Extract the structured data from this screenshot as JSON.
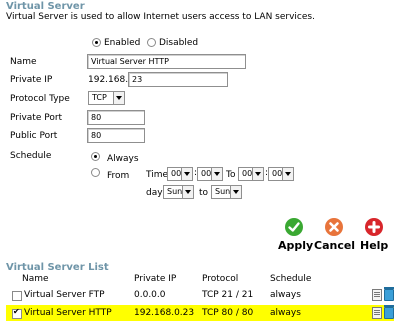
{
  "section": {
    "title": "Virtual Server",
    "description": "Virtual Server is used to allow Internet users access to LAN services."
  },
  "status": {
    "enabled_label": "Enabled",
    "disabled_label": "Disabled",
    "selected": "Enabled"
  },
  "form": {
    "name_label": "Name",
    "name_value": "Virtual Server HTTP",
    "private_ip_label": "Private IP",
    "private_ip_prefix": "192.168.0.",
    "private_ip_value": "23",
    "protocol_label": "Protocol Type",
    "protocol_value": "TCP",
    "private_port_label": "Private Port",
    "private_port_value": "80",
    "public_port_label": "Public Port",
    "public_port_value": "80",
    "schedule_label": "Schedule",
    "always_label": "Always",
    "from_label": "From",
    "schedule_selected": "Always",
    "time_label": "Time",
    "time_from_hour": "00",
    "time_from_min": "00",
    "to_label": "To",
    "time_to_hour": "00",
    "time_to_min": "00",
    "day_label": "day",
    "day_from": "Sun",
    "day_to_label": "to",
    "day_to": "Sun"
  },
  "actions": {
    "apply": "Apply",
    "cancel": "Cancel",
    "help": "Help",
    "colors": {
      "apply": "#3aa832",
      "cancel": "#e8743b",
      "help": "#d8262b"
    }
  },
  "list": {
    "title": "Virtual Server List",
    "headers": [
      "Name",
      "Private IP",
      "Protocol",
      "Schedule"
    ],
    "rows": [
      {
        "checked": false,
        "name": "Virtual Server FTP",
        "ip": "0.0.0.0",
        "protocol": "TCP 21 / 21",
        "schedule": "always",
        "highlight": false
      },
      {
        "checked": true,
        "name": "Virtual Server HTTP",
        "ip": "192.168.0.23",
        "protocol": "TCP 80 / 80",
        "schedule": "always",
        "highlight": true
      }
    ]
  }
}
